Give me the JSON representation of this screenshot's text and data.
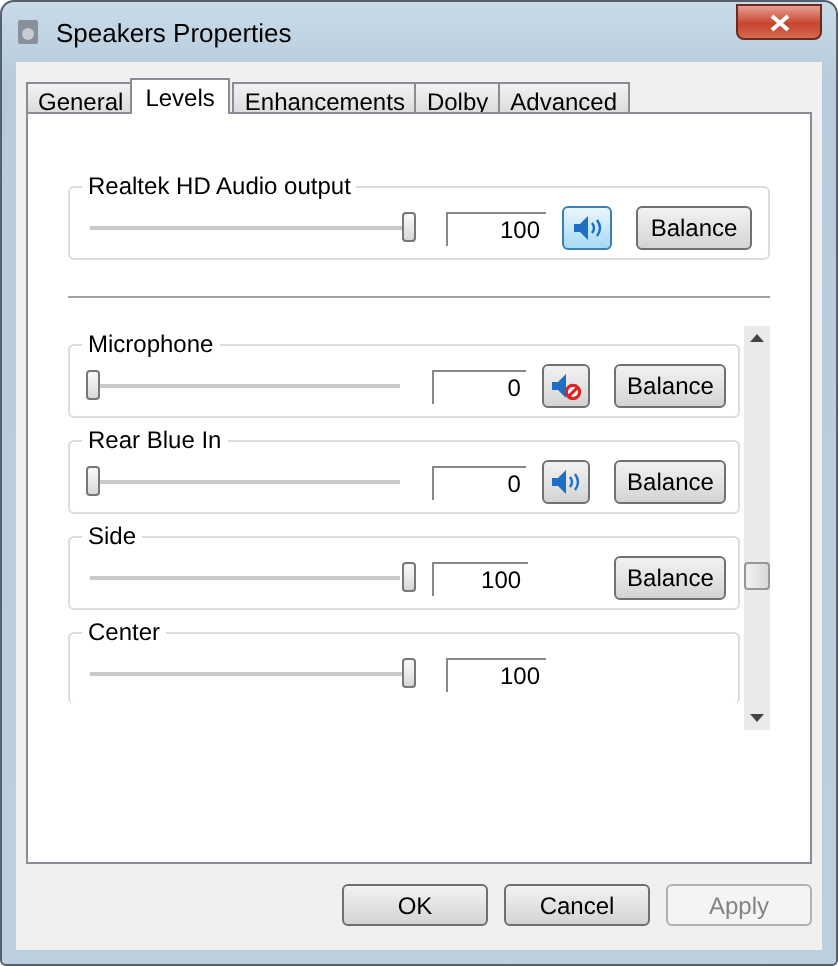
{
  "window": {
    "title": "Speakers Properties"
  },
  "tabs": [
    {
      "label": "General",
      "selected": false
    },
    {
      "label": "Levels",
      "selected": true
    },
    {
      "label": "Enhancements",
      "selected": false
    },
    {
      "label": "Dolby",
      "selected": false
    },
    {
      "label": "Advanced",
      "selected": false
    }
  ],
  "main_channel": {
    "name": "Realtek HD Audio output",
    "level": 1,
    "reading": "100",
    "muted": false,
    "balance": "Balance"
  },
  "channels": [
    {
      "name": "Microphone",
      "level": 0,
      "reading": "0",
      "muted": true,
      "balance": "Balance"
    },
    {
      "name": "Rear Blue In",
      "level": 0,
      "reading": "0",
      "muted": false,
      "balance": "Balance"
    },
    {
      "name": "Side",
      "level": 1,
      "reading": "100",
      "balance": "Balance"
    },
    {
      "name": "Center",
      "level": 1,
      "reading": "100"
    }
  ],
  "buttons": [
    {
      "label": "OK",
      "disabled": false
    },
    {
      "label": "Cancel",
      "disabled": false
    },
    {
      "label": "Apply",
      "disabled": true
    }
  ]
}
